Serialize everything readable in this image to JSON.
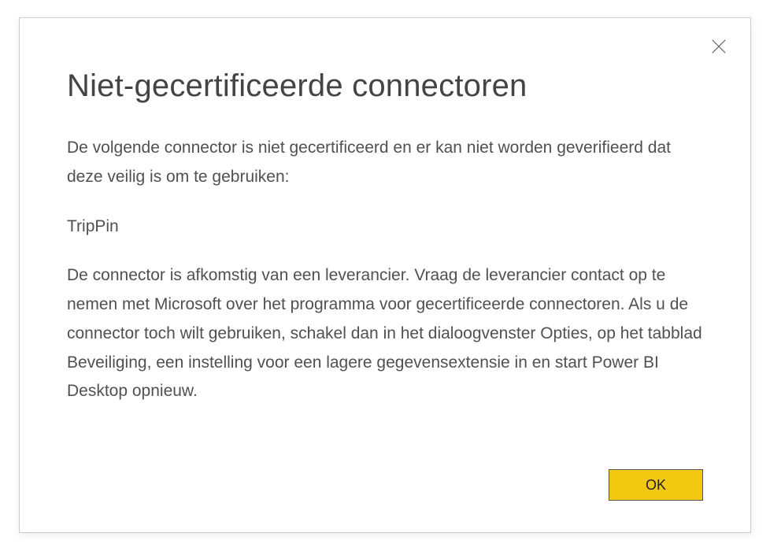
{
  "dialog": {
    "title": "Niet-gecertificeerde connectoren",
    "intro": "De volgende connector is niet gecertificeerd en er kan niet worden geverifieerd dat deze veilig is om te gebruiken:",
    "connector_name": "TripPin",
    "details": "De connector is afkomstig van een leverancier. Vraag de leverancier contact op te nemen met Microsoft over het programma voor gecertificeerde connectoren. Als u de connector toch wilt gebruiken, schakel dan in het dialoogvenster Opties, op het tabblad Beveiliging, een instelling voor een lagere gegevensextensie in en start Power BI Desktop opnieuw.",
    "ok_label": "OK"
  }
}
